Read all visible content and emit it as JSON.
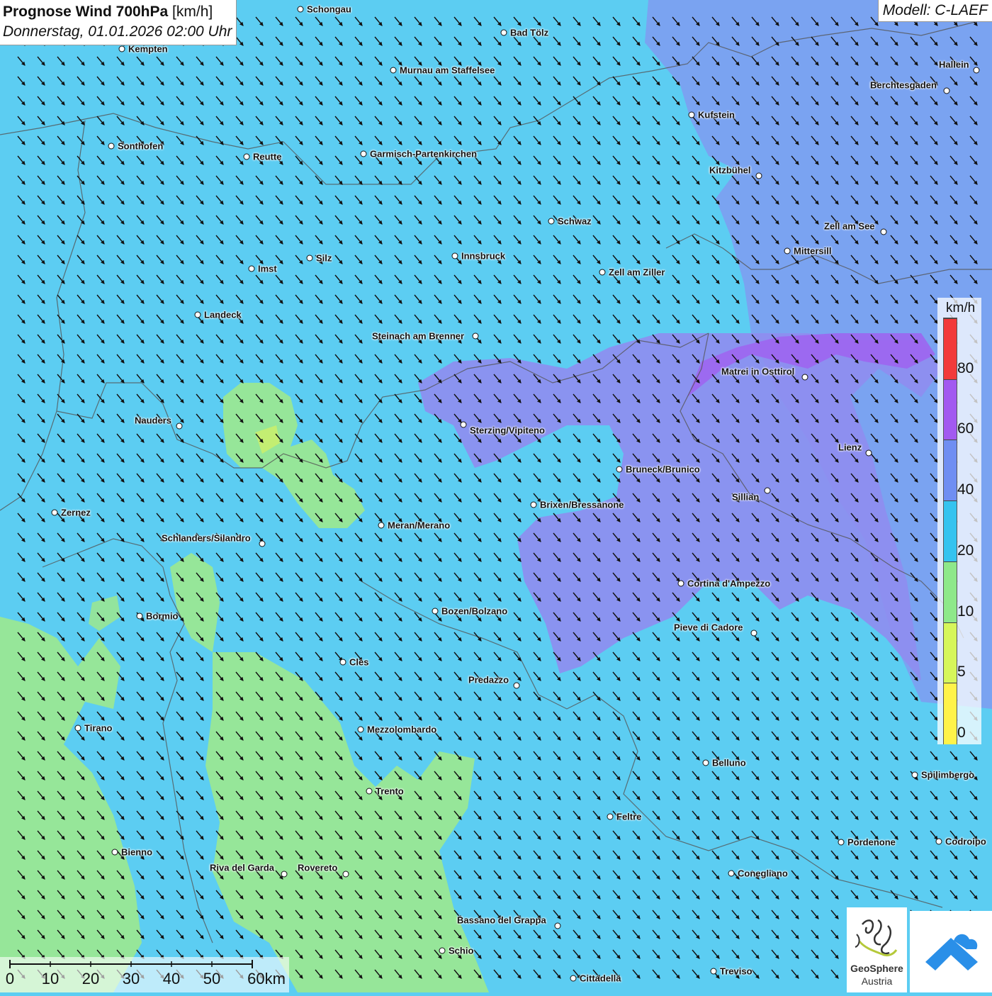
{
  "header": {
    "title_bold": "Prognose Wind 700hPa",
    "title_unit": "[km/h]",
    "datetime": "Donnerstag, 01.01.2026 02:00 Uhr",
    "model": "Modell: C-LAEF"
  },
  "legend": {
    "unit": "km/h",
    "ticks": [
      "80",
      "60",
      "40",
      "20",
      "10",
      "5",
      "0"
    ],
    "colors": [
      "#f23a3a",
      "#a259f0",
      "#6f8ef2",
      "#35c3ef",
      "#8ee88a",
      "#d6f65a",
      "#fff34a"
    ]
  },
  "scale_bar": {
    "labels": [
      "0",
      "10",
      "20",
      "30",
      "40",
      "50",
      "60km"
    ]
  },
  "wind": {
    "direction": "north-west",
    "arrow_color": "#111111"
  },
  "places": [
    {
      "name": "Schongau"
    },
    {
      "name": "Bad Tölz"
    },
    {
      "name": "Kempten"
    },
    {
      "name": "Murnau am Staffelsee"
    },
    {
      "name": "Hallein"
    },
    {
      "name": "Berchtesgaden"
    },
    {
      "name": "Kufstein"
    },
    {
      "name": "Sonthofen"
    },
    {
      "name": "Reutte"
    },
    {
      "name": "Garmisch-Partenkirchen"
    },
    {
      "name": "Kitzbühel"
    },
    {
      "name": "Schwaz"
    },
    {
      "name": "Zell am See"
    },
    {
      "name": "Mittersill"
    },
    {
      "name": "Silz"
    },
    {
      "name": "Innsbruck"
    },
    {
      "name": "Imst"
    },
    {
      "name": "Zell am Ziller"
    },
    {
      "name": "Landeck"
    },
    {
      "name": "Steinach am Brenner"
    },
    {
      "name": "Matrei in Osttirol"
    },
    {
      "name": "Nauders"
    },
    {
      "name": "Sterzing/Vipiteno"
    },
    {
      "name": "Lienz"
    },
    {
      "name": "Bruneck/Brunico"
    },
    {
      "name": "Sillian"
    },
    {
      "name": "Zernez"
    },
    {
      "name": "Brixen/Bressanone"
    },
    {
      "name": "Meran/Merano"
    },
    {
      "name": "Schlanders/Silandro"
    },
    {
      "name": "Cortina d'Ampezzo"
    },
    {
      "name": "Bozen/Bolzano"
    },
    {
      "name": "Bormio"
    },
    {
      "name": "Pieve di Cadore"
    },
    {
      "name": "Cles"
    },
    {
      "name": "Predazzo"
    },
    {
      "name": "Tirano"
    },
    {
      "name": "Mezzolombardo"
    },
    {
      "name": "Belluno"
    },
    {
      "name": "Spilimbergo"
    },
    {
      "name": "Trento"
    },
    {
      "name": "Feltre"
    },
    {
      "name": "Pordenone"
    },
    {
      "name": "Codroipo"
    },
    {
      "name": "Bienno"
    },
    {
      "name": "Riva del Garda"
    },
    {
      "name": "Rovereto"
    },
    {
      "name": "Conegliano"
    },
    {
      "name": "Bassano del Grappa"
    },
    {
      "name": "Schio"
    },
    {
      "name": "Treviso"
    },
    {
      "name": "Cittadella"
    }
  ],
  "logo": {
    "brand_line1": "GeoSphere",
    "brand_line2": "Austria"
  }
}
